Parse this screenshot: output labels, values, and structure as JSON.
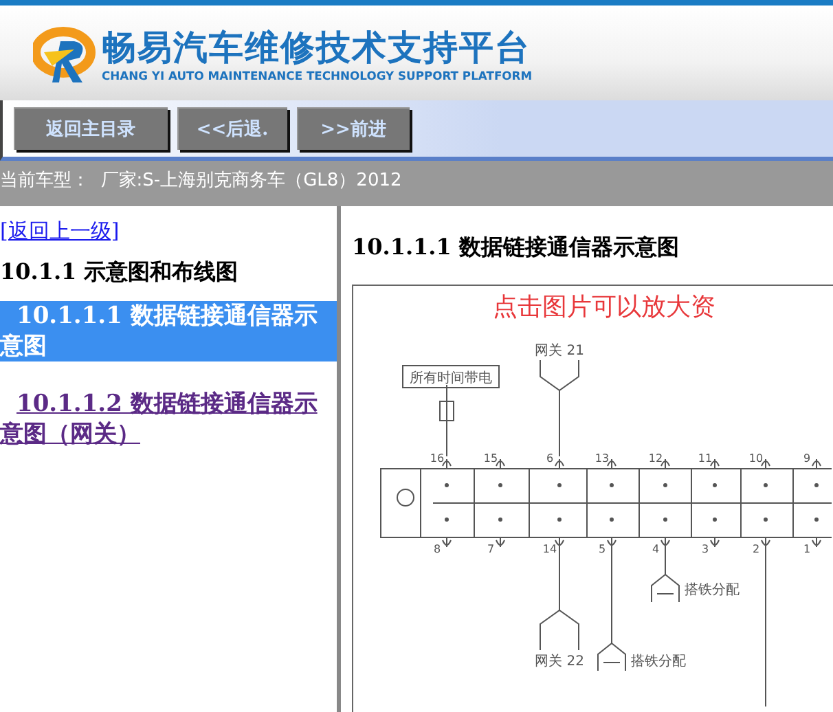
{
  "header": {
    "title": "畅易汽车维修技术支持平台",
    "subtitle": "CHANG YI AUTO MAINTENANCE TECHNOLOGY SUPPORT PLATFORM"
  },
  "nav_buttons": [
    "返回主目录",
    "<<后退.",
    ">>前进"
  ],
  "current_vehicle": "当前车型：  厂家:S-上海别克商务车（GL8）2012",
  "sidebar": {
    "back_link": "[返回上一级]",
    "heading": "10.1.1 示意图和布线图",
    "items": [
      {
        "number": "10.1.1.1",
        "label": "数据链接通信器示意图",
        "selected": true
      },
      {
        "number": "10.1.1.2",
        "label": "数据链接通信器示意图（网关）",
        "selected": false
      }
    ]
  },
  "content": {
    "title": "10.1.1.1 数据链接通信器示意图",
    "image_caption": "点击图片可以放大资",
    "diagram": {
      "power_label": "所有时间带电",
      "top_module": "网关 21",
      "bottom_module": "网关 22",
      "ground_labels": [
        "搭铁分配",
        "搭铁分配"
      ],
      "top_pins": [
        "16",
        "15",
        "6",
        "13",
        "12",
        "11",
        "10",
        "9"
      ],
      "bottom_pins": [
        "8",
        "7",
        "14",
        "5",
        "4",
        "3",
        "2",
        "1"
      ]
    }
  }
}
